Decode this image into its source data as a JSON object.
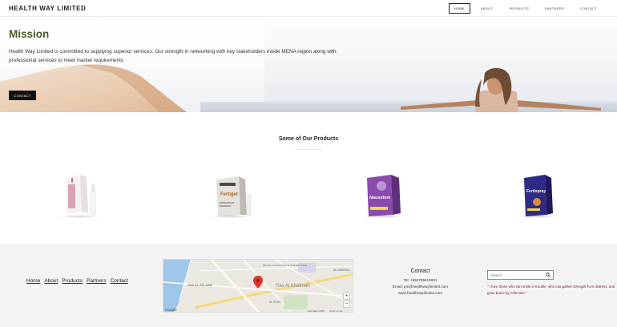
{
  "header": {
    "brand": "HEALTH WAY LIMITED",
    "nav": [
      {
        "label": "HOME",
        "active": true
      },
      {
        "label": "ABOUT",
        "active": false
      },
      {
        "label": "PRODUCTS",
        "active": false
      },
      {
        "label": "PARTNERS",
        "active": false
      },
      {
        "label": "CONTACT",
        "active": false
      }
    ]
  },
  "hero": {
    "title": "Mission",
    "text_line1": "Health Way Limited is committed to supplying superior services. Our strength in networking with key stakeholders inside MENA region along with",
    "text_line2": "professional services to meet market requirements",
    "button_label": "CONTACT"
  },
  "products": {
    "title": "Some of Our Products",
    "items": [
      {
        "name": "pink-box-product",
        "color": "#d8a3b2"
      },
      {
        "name": "fertigel-product",
        "box_text": "Fertigel",
        "color": "#c9c7c2"
      },
      {
        "name": "nausefem-product",
        "box_text": "Nausefem",
        "color": "#7a3f9c"
      },
      {
        "name": "fertispray-product",
        "box_text": "Fertispray",
        "color": "#2f2a86"
      }
    ]
  },
  "footer": {
    "links": [
      "Home",
      "About",
      "Products",
      "Partners",
      "Contact"
    ],
    "map": {
      "labels": [
        "RAS AL SELAAB",
        "Ministry of Interior Ras Al Khaimah Police",
        "Ras Al Khaimah",
        "AL SEER",
        "AL NAKHEEL",
        "Google",
        "Map data ©2022",
        "Terms of Use"
      ],
      "zoom_in": "+",
      "zoom_out": "−"
    },
    "contact": {
      "title": "Contact",
      "tel": "Tel: +962795619601",
      "email": "Email: gm@healthwaylimited.com",
      "website": "www.healthwaylimited.com"
    },
    "search_placeholder": "Search",
    "quote": "\" I love those who can smile in trouble, who can gather strength from distress, and grow brave by reflection.\""
  }
}
